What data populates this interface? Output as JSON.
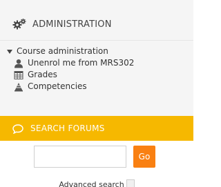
{
  "administration": {
    "icon": "cogs-icon",
    "title": "ADMINISTRATION",
    "tree": {
      "root_label": "Course administration",
      "items": [
        {
          "label": "Unenrol me from MRS302",
          "icon": "user-icon"
        },
        {
          "label": "Grades",
          "icon": "grades-table-icon"
        },
        {
          "label": "Competencies",
          "icon": "competencies-icon"
        }
      ]
    }
  },
  "search_forums": {
    "icon": "comment-icon",
    "title": "SEARCH FORUMS",
    "input": {
      "value": "",
      "placeholder": ""
    },
    "go_label": "Go",
    "advanced_label": "Advanced search",
    "help_icon": "help-icon"
  },
  "colors": {
    "search_header": "#f6b800",
    "go_button": "#f98012",
    "admin_background": "#f5f5f5"
  }
}
